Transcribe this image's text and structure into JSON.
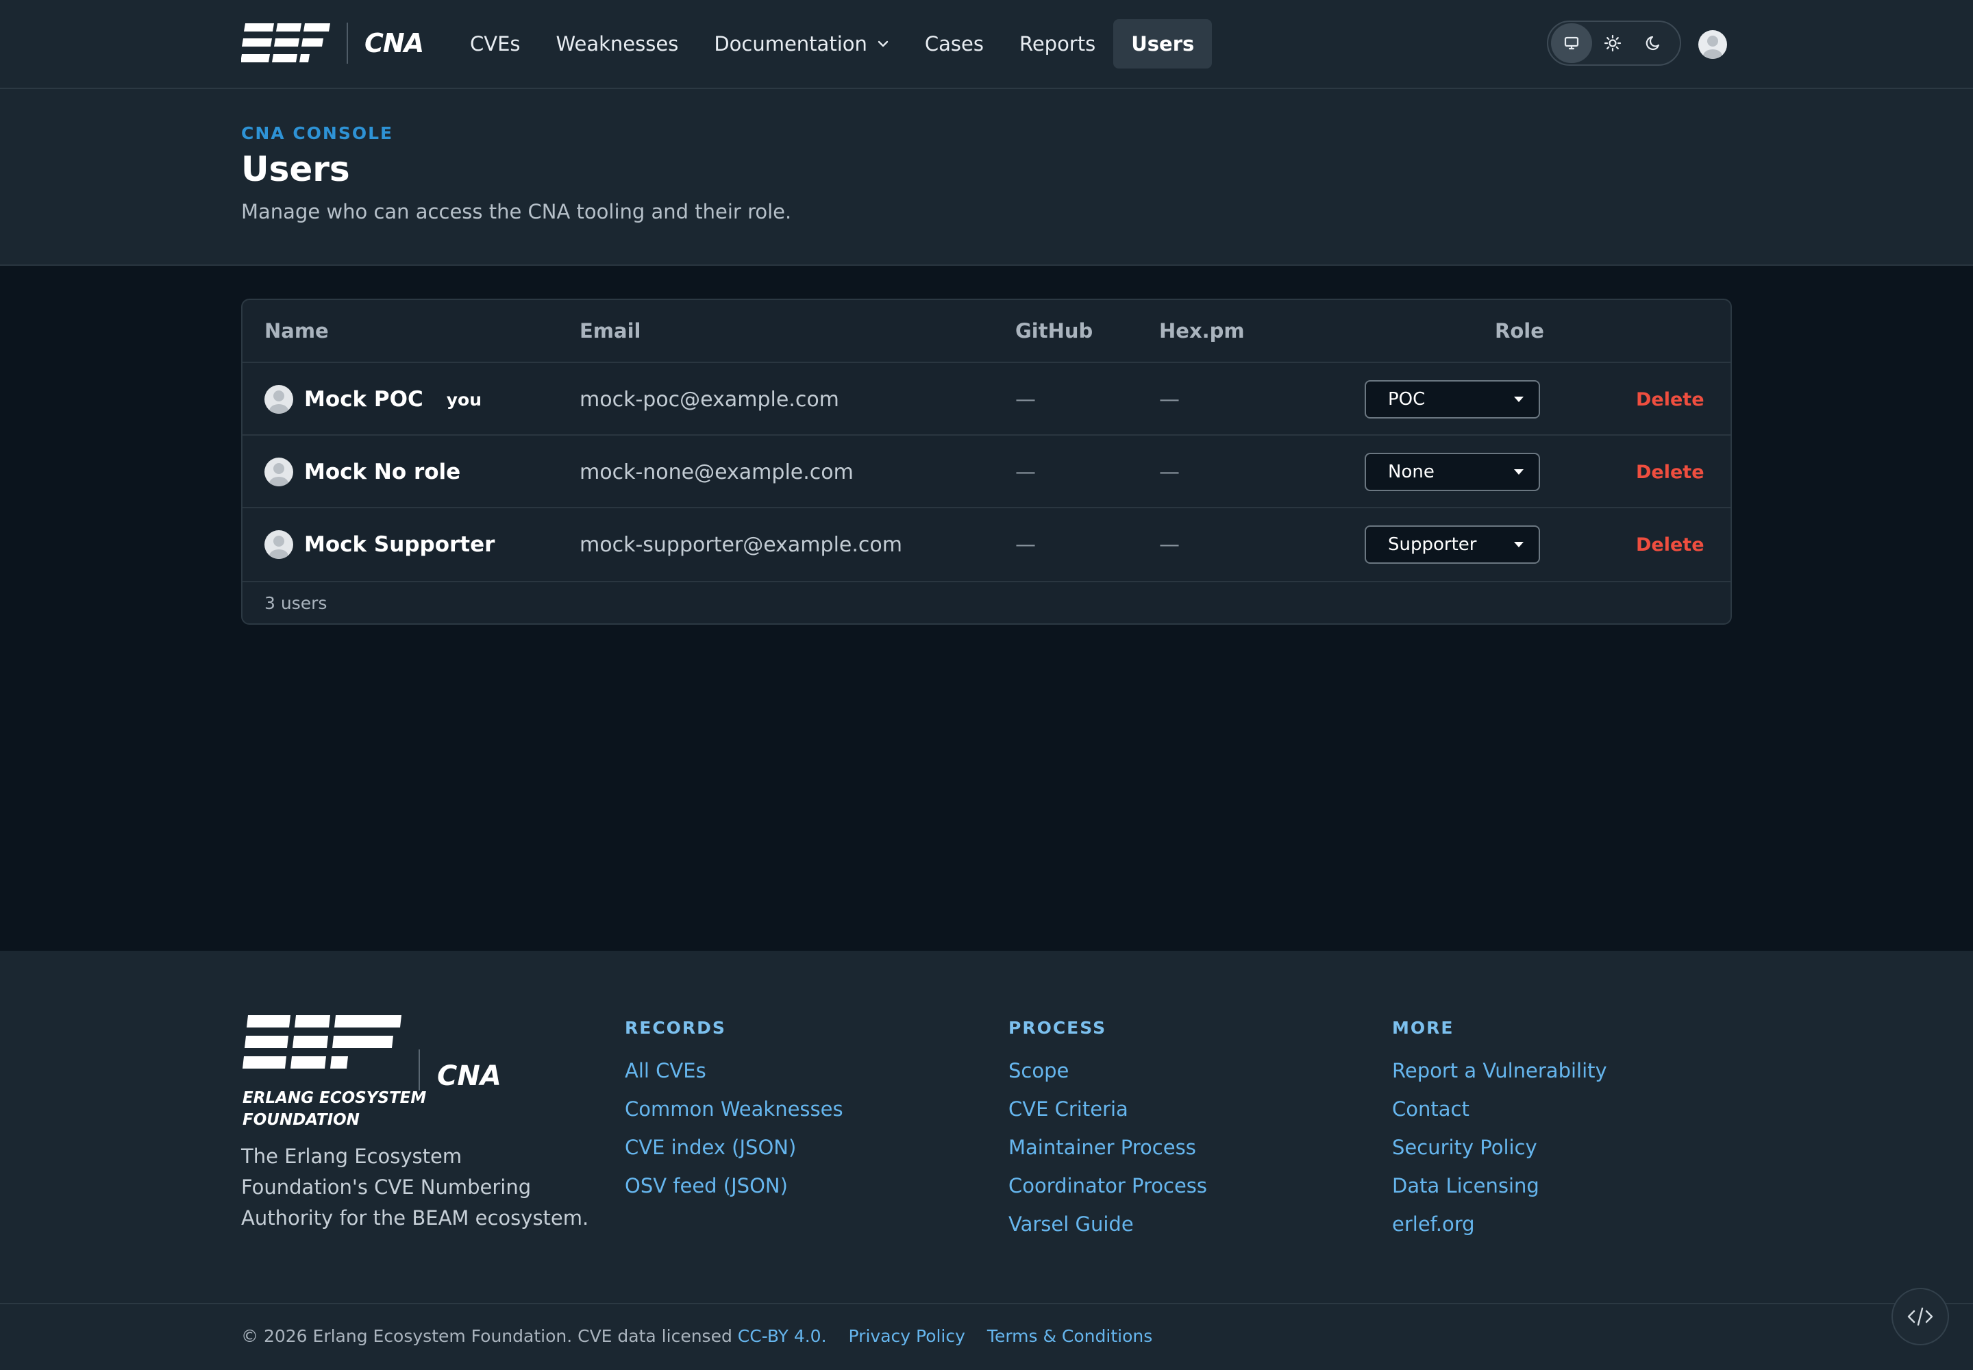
{
  "nav": {
    "brand_cna": "CNA",
    "items": [
      {
        "label": "CVEs"
      },
      {
        "label": "Weaknesses"
      },
      {
        "label": "Documentation",
        "has_dropdown": true
      },
      {
        "label": "Cases"
      },
      {
        "label": "Reports"
      },
      {
        "label": "Users",
        "active": true
      }
    ],
    "theme_modes": [
      "monitor-icon",
      "sun-icon",
      "moon-icon"
    ],
    "theme_active": "monitor-icon"
  },
  "header": {
    "eyebrow": "CNA CONSOLE",
    "title": "Users",
    "description": "Manage who can access the CNA tooling and their role."
  },
  "table": {
    "columns": {
      "name": "Name",
      "email": "Email",
      "github": "GitHub",
      "hexpm": "Hex.pm",
      "role": "Role"
    },
    "rows": [
      {
        "name": "Mock POC",
        "badge": "you",
        "email": "mock-poc@example.com",
        "github": "—",
        "hexpm": "—",
        "role": "POC",
        "action": "Delete"
      },
      {
        "name": "Mock No role",
        "badge": "",
        "email": "mock-none@example.com",
        "github": "—",
        "hexpm": "—",
        "role": "None",
        "action": "Delete"
      },
      {
        "name": "Mock Supporter",
        "badge": "",
        "email": "mock-supporter@example.com",
        "github": "—",
        "hexpm": "—",
        "role": "Supporter",
        "action": "Delete"
      }
    ],
    "count": "3 users"
  },
  "footer": {
    "logo_text_line1": "ERLANG ECOSYSTEM",
    "logo_text_line2": "FOUNDATION",
    "logo_cna": "CNA",
    "tagline": "The Erlang Ecosystem Foundation's CVE Numbering Authority for the BEAM ecosystem.",
    "columns": [
      {
        "heading": "RECORDS",
        "links": [
          "All CVEs",
          "Common Weaknesses",
          "CVE index (JSON)",
          "OSV feed (JSON)"
        ]
      },
      {
        "heading": "PROCESS",
        "links": [
          "Scope",
          "CVE Criteria",
          "Maintainer Process",
          "Coordinator Process",
          "Varsel Guide"
        ]
      },
      {
        "heading": "MORE",
        "links": [
          "Report a Vulnerability",
          "Contact",
          "Security Policy",
          "Data Licensing",
          "erlef.org"
        ]
      }
    ],
    "copyright": "© 2026 Erlang Ecosystem Foundation. CVE data licensed ",
    "license_link": "CC-BY 4.0",
    "license_suffix": ".",
    "privacy": "Privacy Policy",
    "terms": "Terms & Conditions"
  },
  "colors": {
    "accent": "#2e93d6",
    "link": "#66b6ee",
    "danger": "#ef4e3f",
    "surface": "#1b2731",
    "background": "#0b141d"
  }
}
